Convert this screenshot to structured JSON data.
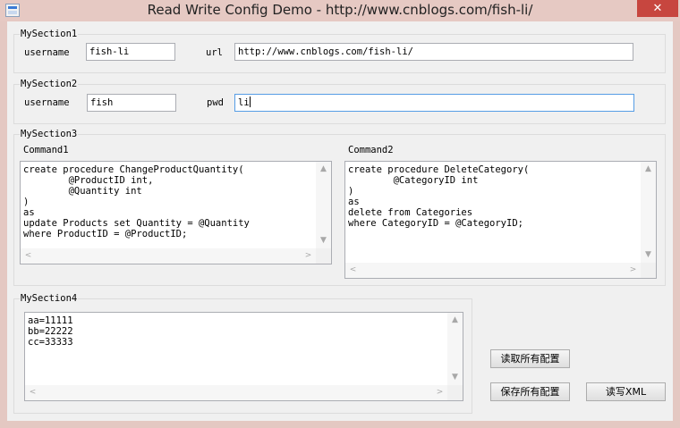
{
  "window": {
    "title": "Read Write Config Demo  - http://www.cnblogs.com/fish-li/",
    "close_glyph": "✕"
  },
  "section1": {
    "title": "MySection1",
    "username_label": "username",
    "username_value": "fish-li",
    "url_label": "url",
    "url_value": "http://www.cnblogs.com/fish-li/"
  },
  "section2": {
    "title": "MySection2",
    "username_label": "username",
    "username_value": "fish",
    "pwd_label": "pwd",
    "pwd_value": "li"
  },
  "section3": {
    "title": "MySection3",
    "command1_label": "Command1",
    "command1_text": "create procedure ChangeProductQuantity(\n        @ProductID int,\n        @Quantity int\n)\nas\nupdate Products set Quantity = @Quantity\nwhere ProductID = @ProductID;",
    "command2_label": "Command2",
    "command2_text": "create procedure DeleteCategory(\n        @CategoryID int\n)\nas\ndelete from Categories\nwhere CategoryID = @CategoryID;"
  },
  "section4": {
    "title": "MySection4",
    "text": "aa=11111\nbb=22222\ncc=33333"
  },
  "buttons": {
    "read_all": "读取所有配置",
    "save_all": "保存所有配置",
    "read_write_xml": "读写XML"
  },
  "scroll": {
    "up": "▲",
    "down": "▼",
    "left": "<",
    "right": ">"
  },
  "colors": {
    "title_bar": "#e6c9c3",
    "close_button": "#c7463f",
    "focus_border": "#569de5"
  }
}
